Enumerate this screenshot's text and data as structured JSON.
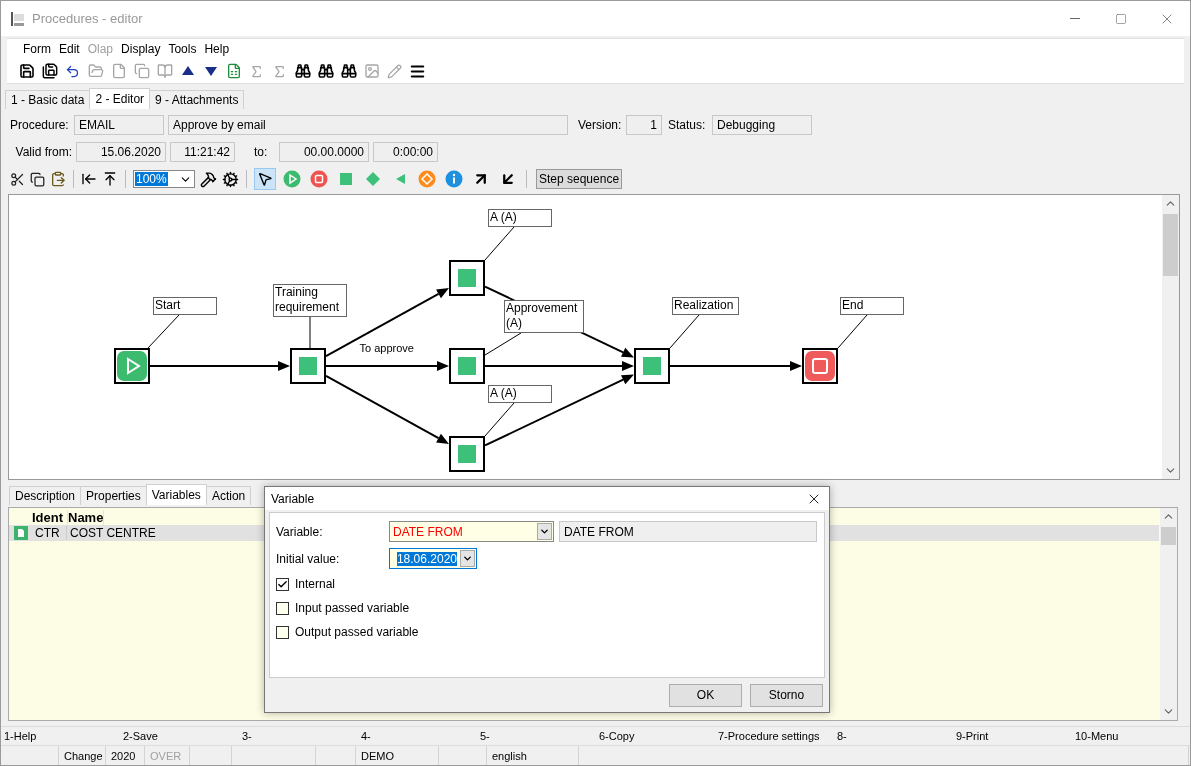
{
  "window": {
    "title": "Procedures - editor"
  },
  "menu": [
    {
      "label": "Form",
      "disabled": false
    },
    {
      "label": "Edit",
      "disabled": false
    },
    {
      "label": "Olap",
      "disabled": true
    },
    {
      "label": "Display",
      "disabled": false
    },
    {
      "label": "Tools",
      "disabled": false
    },
    {
      "label": "Help",
      "disabled": false
    }
  ],
  "toolbar": [
    {
      "kind": "save",
      "disabled": false
    },
    {
      "kind": "save-as",
      "disabled": false
    },
    {
      "kind": "undo",
      "disabled": false
    },
    {
      "kind": "open",
      "disabled": true
    },
    {
      "kind": "new",
      "disabled": true
    },
    {
      "kind": "copy",
      "disabled": true
    },
    {
      "kind": "book",
      "disabled": true
    },
    {
      "kind": "up",
      "disabled": false
    },
    {
      "kind": "down",
      "disabled": false
    },
    {
      "kind": "sheet",
      "disabled": false
    },
    {
      "kind": "sum",
      "disabled": true
    },
    {
      "kind": "sum2",
      "disabled": true
    },
    {
      "kind": "find",
      "disabled": false
    },
    {
      "kind": "find",
      "disabled": false
    },
    {
      "kind": "find",
      "disabled": false
    },
    {
      "kind": "image",
      "disabled": true
    },
    {
      "kind": "edit",
      "disabled": true
    },
    {
      "kind": "menu",
      "disabled": false
    }
  ],
  "tabs": [
    {
      "label": "1 - Basic data",
      "selected": false
    },
    {
      "label": "2 - Editor",
      "selected": true
    },
    {
      "label": "9 - Attachments",
      "selected": false
    }
  ],
  "procedure": {
    "label": "Procedure:",
    "code": "EMAIL",
    "name": "Approve by email"
  },
  "version": {
    "label": "Version:",
    "value": "1"
  },
  "status": {
    "label": "Status:",
    "value": "Debugging"
  },
  "valid_from": {
    "label": "Valid from:",
    "date": "15.06.2020",
    "time": "11:21:42"
  },
  "valid_to": {
    "label": "to:",
    "date": "00.00.0000",
    "time": "0:00:00"
  },
  "zoom": {
    "value": "100%"
  },
  "editor_tools": [
    {
      "kind": "pointer",
      "selected": true
    },
    {
      "kind": "start",
      "selected": false
    },
    {
      "kind": "stop",
      "selected": false
    },
    {
      "kind": "task",
      "selected": false
    },
    {
      "kind": "decision",
      "selected": false
    },
    {
      "kind": "merge",
      "selected": false
    },
    {
      "kind": "event",
      "selected": false
    },
    {
      "kind": "info",
      "selected": false
    },
    {
      "kind": "arrow-out",
      "selected": false
    },
    {
      "kind": "arrow-in",
      "selected": false
    }
  ],
  "step_button": {
    "label": "Step sequence",
    "pressed": true
  },
  "diagram": {
    "nodes": [
      {
        "kind": "start",
        "label": "Start"
      },
      {
        "kind": "task",
        "label": "Training requirement"
      },
      {
        "kind": "task",
        "label": "A (A)"
      },
      {
        "kind": "task",
        "label": "Approvement (A)"
      },
      {
        "kind": "task",
        "label": "A (A)"
      },
      {
        "kind": "task",
        "label": "Realization"
      },
      {
        "kind": "end",
        "label": "End"
      }
    ],
    "edge_label": "To approve"
  },
  "bottom_tabs": [
    {
      "label": "Description",
      "selected": false
    },
    {
      "label": "Properties",
      "selected": false
    },
    {
      "label": "Variables",
      "selected": true
    },
    {
      "label": "Action",
      "selected": false
    }
  ],
  "table": {
    "columns": [
      "Ident",
      "Name"
    ],
    "rows": [
      {
        "cells": [
          "CTR",
          "COST CENTRE"
        ],
        "selected": true
      }
    ]
  },
  "dialog": {
    "title": "Variable",
    "variable_label": "Variable:",
    "variable_value": "DATE FROM",
    "variable_description": "DATE FROM",
    "initial_label": "Initial value:",
    "initial_value": "18.06.2020",
    "checkboxes": [
      {
        "label": "Internal",
        "checked": true
      },
      {
        "label": "Input passed variable",
        "checked": false
      },
      {
        "label": "Output passed variable",
        "checked": false
      }
    ],
    "buttons": [
      "OK",
      "Storno"
    ]
  },
  "function_keys": [
    "1-Help",
    "2-Save",
    "3-",
    "4-",
    "5-",
    "6-Copy",
    "7-Procedure settings",
    "8-",
    "9-Print",
    "10-Menu"
  ],
  "status_bar": [
    {
      "text": "Change",
      "disabled": false
    },
    {
      "text": "2020",
      "disabled": false
    },
    {
      "text": "OVER",
      "disabled": true
    },
    {
      "text": "DEMO",
      "disabled": false
    },
    {
      "text": "english",
      "disabled": false
    }
  ]
}
